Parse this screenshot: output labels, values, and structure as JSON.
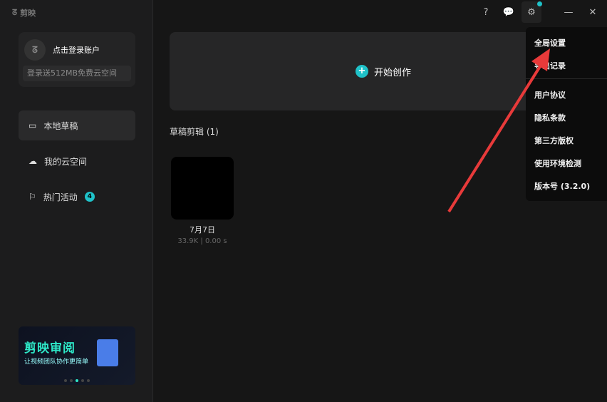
{
  "app": {
    "logo_text": "剪映"
  },
  "account": {
    "name": "点击登录账户",
    "promo": "登录送512MB免费云空间"
  },
  "nav": [
    {
      "label": "本地草稿"
    },
    {
      "label": "我的云空间"
    },
    {
      "label": "热门活动",
      "badge": "4"
    }
  ],
  "banner": {
    "title": "剪映审阅",
    "subtitle": "让视频团队协作更简单",
    "slide_index": 3,
    "slide_count": 5
  },
  "main": {
    "create_label": "开始创作",
    "section_title": "草稿剪辑 (1)",
    "drafts": [
      {
        "name": "7月7日",
        "meta": "33.9K | 0.00 s"
      }
    ]
  },
  "menu": {
    "items": [
      "全局设置",
      "导出记录",
      "用户协议",
      "隐私条款",
      "第三方版权",
      "使用环境检测",
      "版本号 (3.2.0)"
    ]
  },
  "colors": {
    "accent": "#1fc2c9",
    "arrow": "#e83a3a"
  }
}
